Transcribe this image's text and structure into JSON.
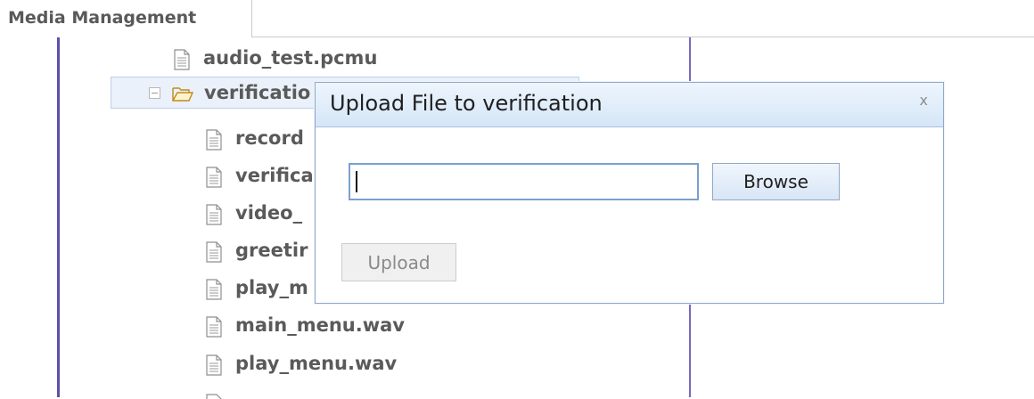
{
  "tab": {
    "label": "Media Management"
  },
  "tree": {
    "items": [
      {
        "name": "audio_test.pcmu",
        "type": "file"
      },
      {
        "name": "verificatio",
        "type": "folder",
        "expanded": true,
        "selected": true
      },
      {
        "name": "record",
        "type": "file"
      },
      {
        "name": "verifica",
        "type": "file"
      },
      {
        "name": "video_",
        "type": "file"
      },
      {
        "name": "greetir",
        "type": "file"
      },
      {
        "name": "play_m",
        "type": "file"
      },
      {
        "name": "main_menu.wav",
        "type": "file"
      },
      {
        "name": "play_menu.wav",
        "type": "file"
      }
    ]
  },
  "dialog": {
    "title": "Upload File to verification",
    "close_label": "x",
    "file_value": "",
    "browse_label": "Browse",
    "upload_label": "Upload",
    "upload_enabled": false
  },
  "colors": {
    "tree_line": "#7a68c2",
    "dialog_header": "#d5e6f8",
    "input_border": "#7aa0cd",
    "selected_row": "#eaf1fa"
  },
  "icons": {
    "file": "file-icon",
    "folder": "folder-open-icon",
    "toggle": "collapse-minus-icon"
  }
}
